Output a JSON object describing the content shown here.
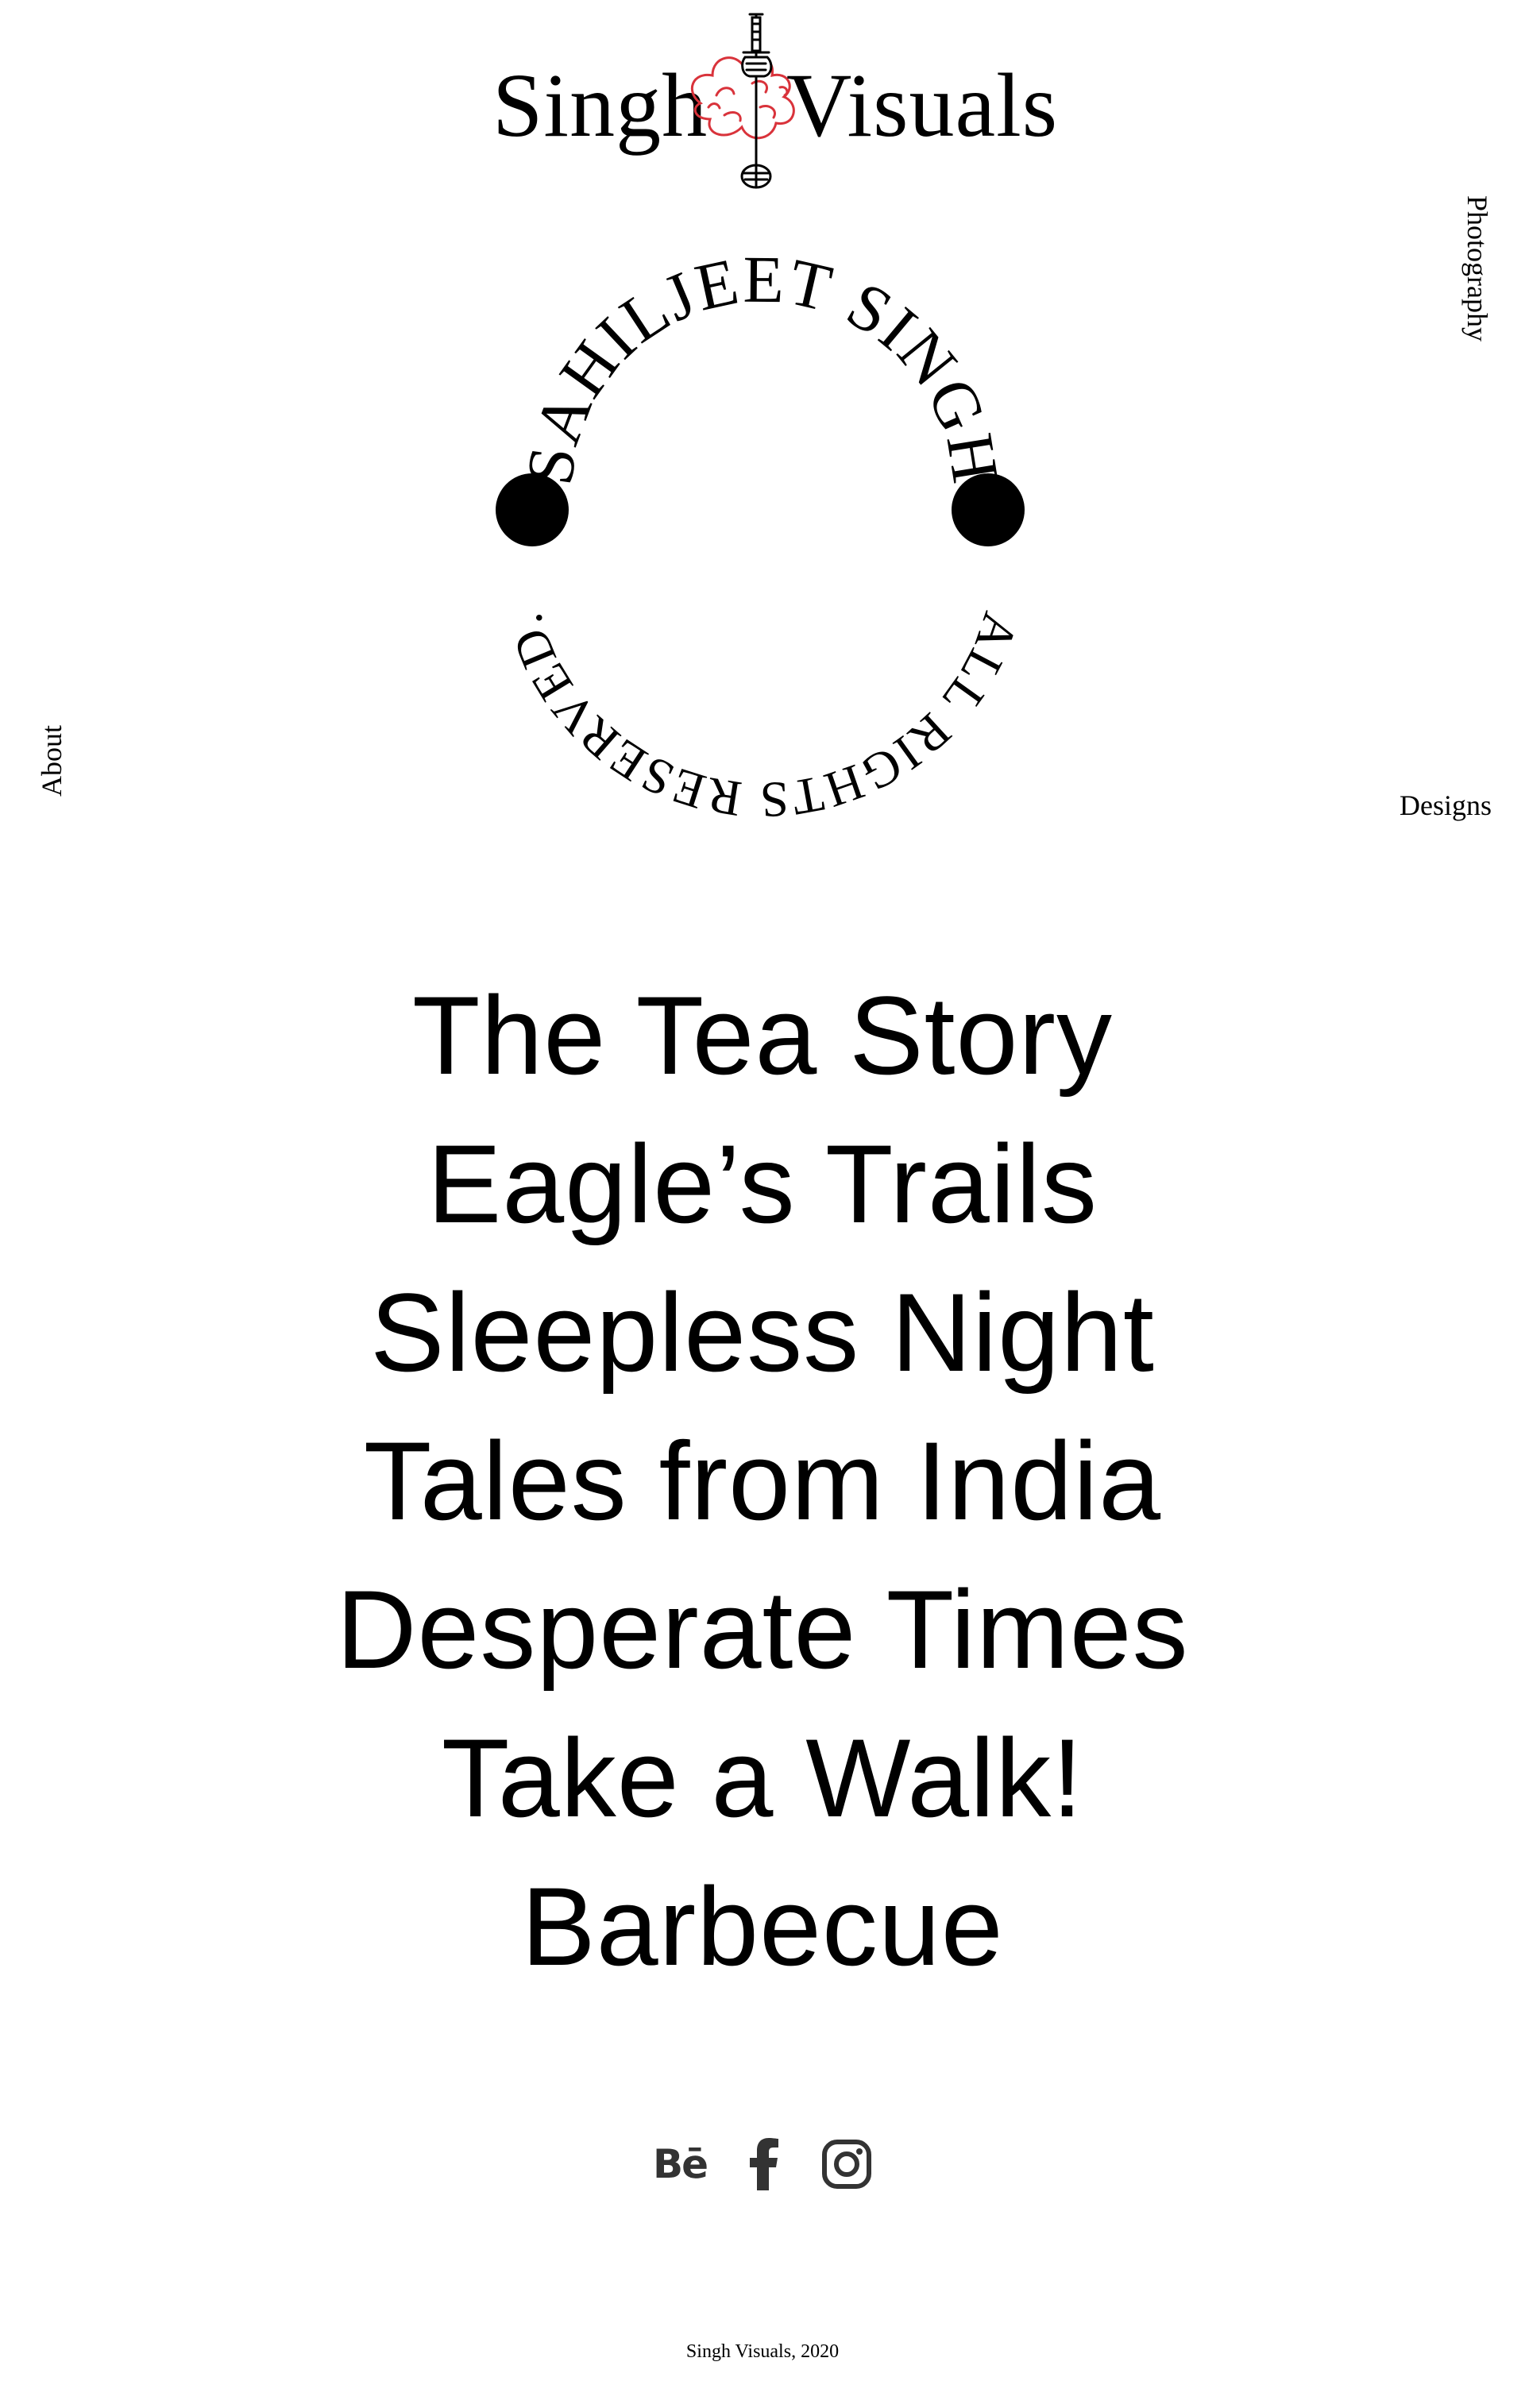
{
  "header": {
    "logo_left": "Singh",
    "logo_right": "Visuals",
    "accent_color": "#d9333b"
  },
  "badge": {
    "top_text": "SAHILJEET SINGH",
    "bottom_text": "ALL RIGHTS RESERVED."
  },
  "nav": {
    "about": "About",
    "photography": "Photography",
    "designs": "Designs"
  },
  "projects": [
    "The Tea Story",
    "Eagle’s Trails",
    "Sleepless Night",
    "Tales from India",
    "Desperate Times",
    "Take a Walk!",
    "Barbecue"
  ],
  "socials": {
    "behance": "Bē",
    "facebook_icon": "facebook-icon",
    "instagram_icon": "instagram-icon"
  },
  "footer": {
    "text": "Singh Visuals, 2020"
  }
}
